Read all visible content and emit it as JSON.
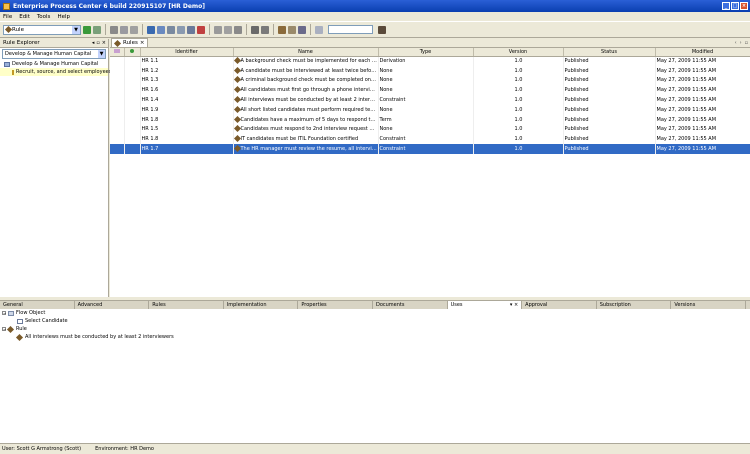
{
  "window": {
    "title": "Enterprise Process Center 6 build 220915107 [HR Demo]"
  },
  "menu": [
    "File",
    "Edit",
    "Tools",
    "Help"
  ],
  "toolbar": {
    "type_combo": "Rule",
    "search_value": ""
  },
  "left_panel": {
    "title": "Rule Explorer",
    "combo": "Develop & Manage Human Capital",
    "tree": [
      {
        "label": "Develop & Manage Human Capital",
        "level": 0
      },
      {
        "label": "Recruit, source, and select employees",
        "level": 1
      }
    ]
  },
  "main": {
    "tab_label": "Rules",
    "columns": [
      "Identifier",
      "Name",
      "Type",
      "Version",
      "Status",
      "Modified"
    ],
    "rows": [
      [
        "HR 1.1",
        "A background check must be implemented for each candidate",
        "Derivation",
        "1.0",
        "Published",
        "May 27, 2009 11:55 AM"
      ],
      [
        "HR 1.2",
        "A candidate must be interviewed at least twice before they c...",
        "None",
        "1.0",
        "Published",
        "May 27, 2009 11:55 AM"
      ],
      [
        "HR 1.3",
        "A criminal background check must be completed on all position...",
        "None",
        "1.0",
        "Published",
        "May 27, 2009 11:55 AM"
      ],
      [
        "HR 1.6",
        "All candidates must first go through a phone interview before ...",
        "None",
        "1.0",
        "Published",
        "May 27, 2009 11:55 AM"
      ],
      [
        "HR 1.4",
        "All interviews must be conducted by at least 2 interviewers",
        "Constraint",
        "1.0",
        "Published",
        "May 27, 2009 11:55 AM"
      ],
      [
        "HR 1.9",
        "All short listed candidates must perform required testing.",
        "None",
        "1.0",
        "Published",
        "May 27, 2009 11:55 AM"
      ],
      [
        "HR 1.8",
        "Candidates have a maximum of 5 days to respond to an inter...",
        "Term",
        "1.0",
        "Published",
        "May 27, 2009 11:55 AM"
      ],
      [
        "HR 1.5",
        "Candidates must respond to 2nd interview request within 5 d...",
        "None",
        "1.0",
        "Published",
        "May 27, 2009 11:55 AM"
      ],
      [
        "HR 1.8",
        "IT candidates must be ITIL Foundation certified",
        "Constraint",
        "1.0",
        "Published",
        "May 27, 2009 11:55 AM"
      ],
      [
        "HR 1.7",
        "The HR manager must review the resume, all interview notes ...",
        "Constraint",
        "1.0",
        "Published",
        "May 27, 2009 11:55 AM"
      ]
    ],
    "selected_row": 9
  },
  "bottom_tabs": [
    "General",
    "Advanced",
    "Rules",
    "Implementation",
    "Properties",
    "Documents",
    "Uses",
    "Approval",
    "Subscription",
    "Versions"
  ],
  "bottom_active": "Uses",
  "bottom_tree": {
    "flow_object": "Flow Object",
    "flow_child": "Select Candidate",
    "rule": "Rule",
    "rule_child": "All interviews must be conducted by at least 2 interviewers"
  },
  "status": {
    "user": "User: Scott G Armstrong (Scott)",
    "environment": "Environment: HR Demo"
  }
}
